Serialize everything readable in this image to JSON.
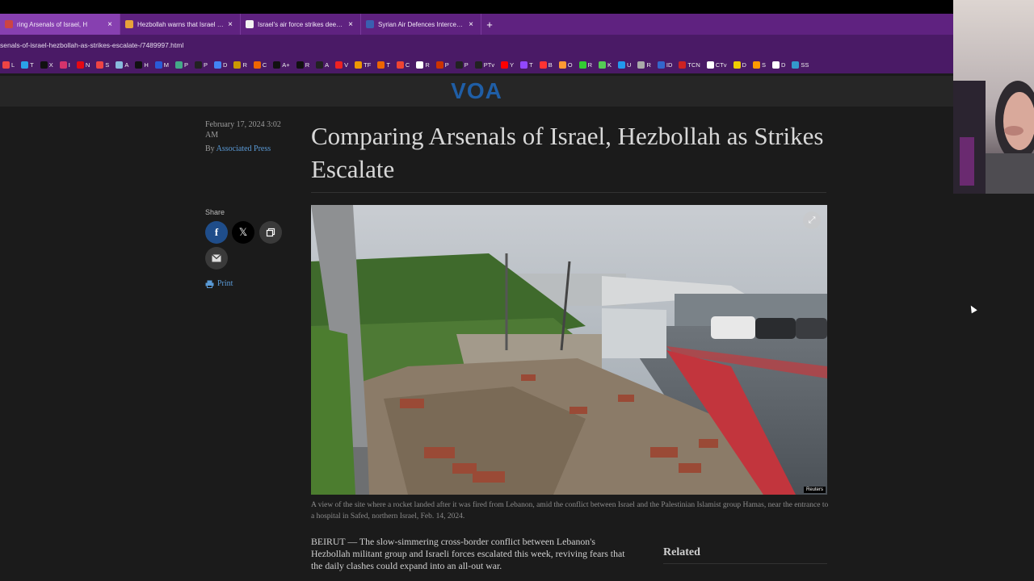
{
  "browser": {
    "tabs": [
      {
        "title": "ring Arsenals of Israel, H",
        "active": true,
        "color": "#c44"
      },
      {
        "title": "Hezbollah warns that Israel will",
        "active": false,
        "color": "#e8a23a"
      },
      {
        "title": "Israel's air force strikes deep in",
        "active": false,
        "color": "#f2f2f2"
      },
      {
        "title": "Syrian Air Defences Intercept Is",
        "active": false,
        "color": "#3a5fb0"
      }
    ],
    "new_tab": "+",
    "url": "senals-of-israel-hezbollah-as-strikes-escalate-/7489997.html",
    "bookmarks": [
      {
        "label": "L",
        "color": "#e44"
      },
      {
        "label": "T",
        "color": "#2aa3e8"
      },
      {
        "label": "X",
        "color": "#111"
      },
      {
        "label": "I",
        "color": "#d6336c"
      },
      {
        "label": "N",
        "color": "#e50914"
      },
      {
        "label": "S",
        "color": "#e44"
      },
      {
        "label": "A",
        "color": "#8bd"
      },
      {
        "label": "H",
        "color": "#111"
      },
      {
        "label": "M",
        "color": "#2a5bd7"
      },
      {
        "label": "P",
        "color": "#4a8"
      },
      {
        "label": "P",
        "color": "#222"
      },
      {
        "label": "D",
        "color": "#4285f4"
      },
      {
        "label": "R",
        "color": "#c90"
      },
      {
        "label": "C",
        "color": "#e60"
      },
      {
        "label": "A+",
        "color": "#111"
      },
      {
        "label": "R",
        "color": "#111"
      },
      {
        "label": "A",
        "color": "#222"
      },
      {
        "label": "V",
        "color": "#e22"
      },
      {
        "label": "TF",
        "color": "#e90"
      },
      {
        "label": "T",
        "color": "#e60"
      },
      {
        "label": "C",
        "color": "#e43"
      },
      {
        "label": "R",
        "color": "#fff"
      },
      {
        "label": "P",
        "color": "#c30"
      },
      {
        "label": "P",
        "color": "#222"
      },
      {
        "label": "PTv",
        "color": "#222"
      },
      {
        "label": "Y",
        "color": "#f00"
      },
      {
        "label": "T",
        "color": "#9147ff"
      },
      {
        "label": "B",
        "color": "#f33"
      },
      {
        "label": "O",
        "color": "#f93"
      },
      {
        "label": "R",
        "color": "#3c3"
      },
      {
        "label": "K",
        "color": "#5c5"
      },
      {
        "label": "U",
        "color": "#29e"
      },
      {
        "label": "R",
        "color": "#aaa"
      },
      {
        "label": "ID",
        "color": "#36c"
      },
      {
        "label": "TCN",
        "color": "#c22"
      },
      {
        "label": "CTv",
        "color": "#fff"
      },
      {
        "label": "D",
        "color": "#ec0"
      },
      {
        "label": "S",
        "color": "#f90"
      },
      {
        "label": "D",
        "color": "#fff"
      },
      {
        "label": "SS",
        "color": "#39c"
      }
    ]
  },
  "site": {
    "logo": "VOA"
  },
  "article": {
    "date": "February 17, 2024 3:02 AM",
    "by_prefix": "By",
    "author": "Associated Press",
    "headline": "Comparing Arsenals of Israel, Hezbollah as Strikes Escalate",
    "share_label": "Share",
    "print_label": "Print",
    "photo_credit": "Reuters",
    "caption": "A view of the site where a rocket landed after it was fired from Lebanon, amid the conflict between Israel and the Palestinian Islamist group Hamas, near the entrance to a hospital in Safed, northern Israel, Feb. 14, 2024.",
    "body_lead": "BEIRUT — The slow-simmering cross-border conflict between Lebanon's Hezbollah militant group and Israeli forces escalated this week, reviving fears that the daily clashes could expand into an all-out war.",
    "related_heading": "Related"
  },
  "colors": {
    "tabbar": "#5f2280",
    "link": "#5a9ad6",
    "voa_blue": "#1f5ea6",
    "facebook": "#1f4d8a"
  }
}
